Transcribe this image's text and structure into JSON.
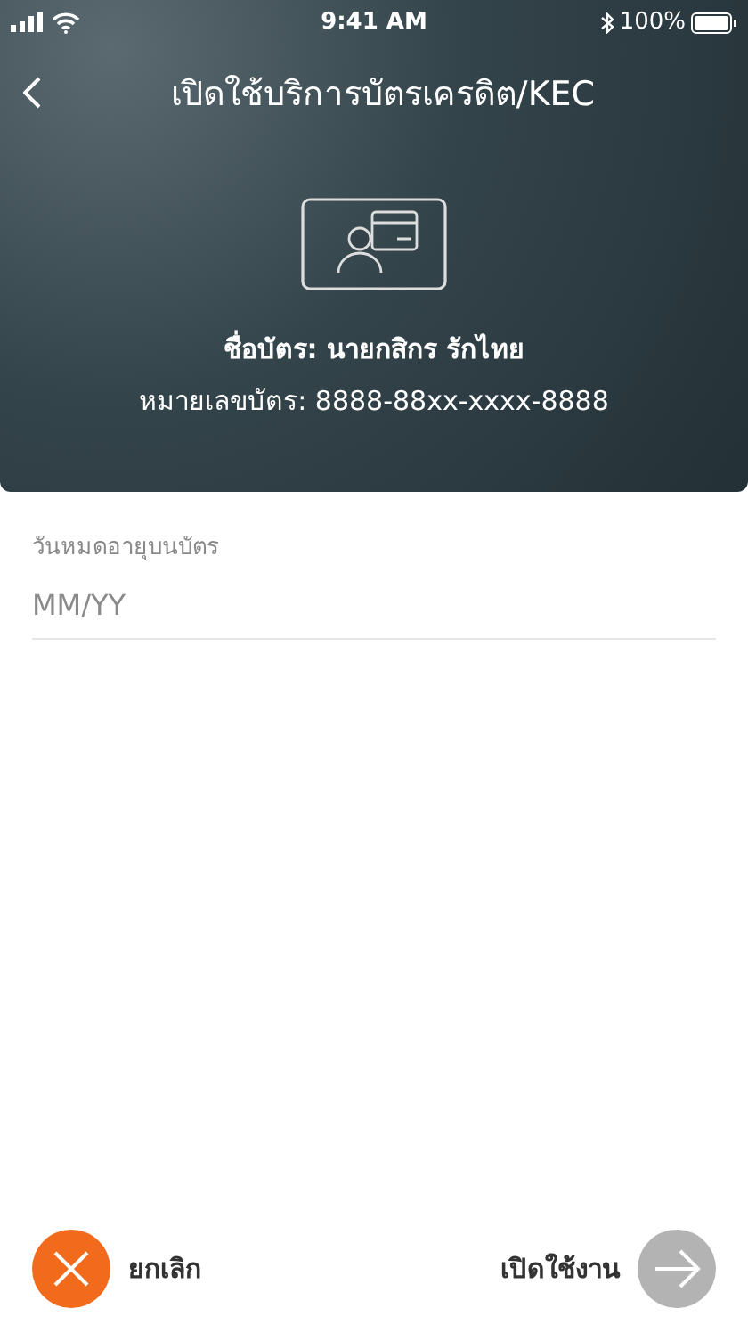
{
  "status_bar": {
    "time": "9:41 AM",
    "battery": "100%"
  },
  "header": {
    "title": "เปิดใช้บริการบัตรเครดิต/KEC",
    "card_name": "ชื่อบัตร: นายกสิกร รักไทย",
    "card_number": "หมายเลขบัตร: 8888-88xx-xxxx-8888"
  },
  "form": {
    "label": "วันหมดอายุบนบัตร",
    "placeholder": "MM/YY"
  },
  "actions": {
    "cancel": {
      "label": "ยกเลิก"
    },
    "confirm": {
      "label": "เปิดใช้งาน",
      "disabled": true
    }
  }
}
